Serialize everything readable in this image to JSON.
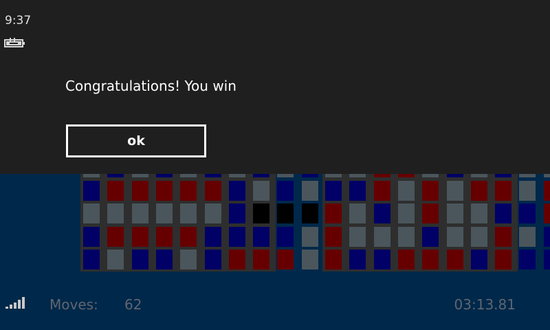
{
  "status": {
    "time": "9:37"
  },
  "dialog": {
    "message": "Congratulations! You win",
    "ok_label": "ok"
  },
  "footer": {
    "moves_label": "Moves:",
    "moves_value": "62",
    "timer": "03:13.81"
  },
  "colors": {
    "b": "#000066",
    "r": "#660000",
    "g": "#4a565c",
    "k": "#000000"
  },
  "boards": [
    {
      "rows": [
        [
          "g",
          "b",
          "g",
          "b",
          "g",
          "b",
          "g",
          "b",
          "g",
          "b"
        ],
        [
          "b",
          "r",
          "r",
          "r",
          "r",
          "r",
          "b",
          "g",
          "b",
          "g"
        ],
        [
          "g",
          "g",
          "g",
          "g",
          "g",
          "g",
          "b",
          "k",
          "k",
          "k"
        ],
        [
          "b",
          "r",
          "r",
          "r",
          "r",
          "b",
          "b",
          "b",
          "b",
          "g"
        ],
        [
          "b",
          "g",
          "b",
          "b",
          "g",
          "b",
          "r",
          "r",
          "r",
          "g"
        ]
      ]
    },
    {
      "rows": [
        [
          "g",
          "g",
          "r",
          "r",
          "g",
          "b",
          "g",
          "b",
          "g",
          "g"
        ],
        [
          "b",
          "b",
          "r",
          "g",
          "r",
          "g",
          "r",
          "r",
          "g",
          "r"
        ],
        [
          "r",
          "g",
          "b",
          "g",
          "r",
          "g",
          "g",
          "b",
          "b",
          "r"
        ],
        [
          "r",
          "g",
          "g",
          "g",
          "b",
          "g",
          "g",
          "r",
          "g",
          "b"
        ],
        [
          "r",
          "b",
          "b",
          "r",
          "r",
          "r",
          "b",
          "r",
          "b",
          "b"
        ]
      ]
    }
  ]
}
